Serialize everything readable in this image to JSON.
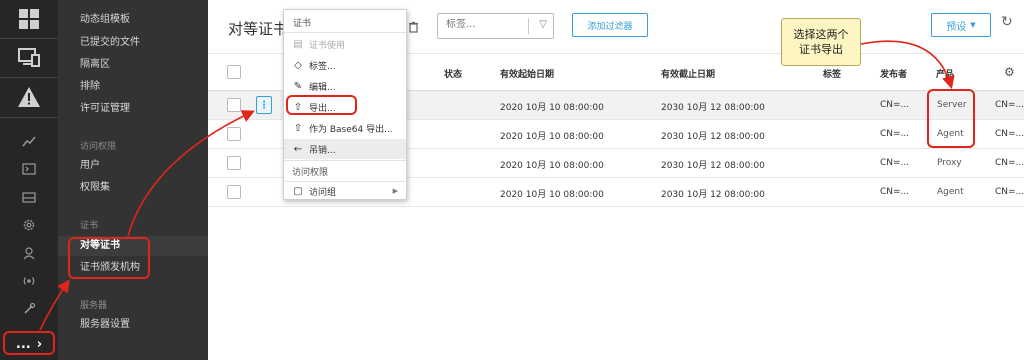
{
  "rail": {
    "icons": [
      "dashboard-grid-icon",
      "devices-icon",
      "warning-icon",
      "chart-icon",
      "terminal-icon",
      "inbox-icon",
      "settings-icon",
      "user-icon",
      "broadcast-icon",
      "tools-icon"
    ],
    "more_label": "..."
  },
  "nav": {
    "items_top": [
      "动态组模板",
      "已提交的文件",
      "隔离区",
      "排除",
      "许可证管理"
    ],
    "section_access": "访问权限",
    "items_access": [
      "用户",
      "权限集"
    ],
    "section_cert": "证书",
    "items_cert": [
      "对等证书",
      "证书颁发机构"
    ],
    "section_server": "服务器",
    "items_server": [
      "服务器设置"
    ]
  },
  "header": {
    "title": "对等证书",
    "tags_placeholder": "标签...",
    "add_filter": "添加过滤器",
    "preset": "预设"
  },
  "table": {
    "columns": [
      "状态",
      "有效起始日期",
      "有效截止日期",
      "标签",
      "发布者",
      "产品"
    ],
    "rows": [
      {
        "valid_from": "2020 10月 10 08:00:00",
        "valid_to": "2030 10月 12 08:00:00",
        "issuer": "CN=...",
        "product": "Server",
        "extra": "CN=..."
      },
      {
        "valid_from": "2020 10月 10 08:00:00",
        "valid_to": "2030 10月 12 08:00:00",
        "issuer": "CN=...",
        "product": "Agent",
        "extra": "CN=..."
      },
      {
        "valid_from": "2020 10月 10 08:00:00",
        "valid_to": "2030 10月 12 08:00:00",
        "issuer": "CN=...",
        "product": "Proxy",
        "extra": "CN=..."
      },
      {
        "valid_from": "2020 10月 10 08:00:00",
        "valid_to": "2030 10月 12 08:00:00",
        "issuer": "CN=...",
        "product": "Agent",
        "extra": "CN=..."
      }
    ]
  },
  "context_menu": {
    "title": "证书",
    "items": [
      {
        "label": "证书使用",
        "icon": "certificate-icon",
        "disabled": true
      },
      {
        "label": "标签...",
        "icon": "tag-icon"
      },
      {
        "label": "编辑...",
        "icon": "pencil-icon"
      },
      {
        "label": "导出...",
        "icon": "export-icon"
      },
      {
        "label": "作为 Base64 导出...",
        "icon": "export-base64-icon"
      },
      {
        "label": "吊销...",
        "icon": "revoke-arrow-icon"
      }
    ],
    "access_section": "访问权限",
    "access_group": "访问组"
  },
  "callout": {
    "line1": "选择这两个",
    "line2": "证书导出"
  },
  "colors": {
    "accent": "#3a9fd8",
    "annotation_red": "#e0251b",
    "callout_bg": "#fdf6c3",
    "rail_bg": "#262626",
    "nav_bg": "#333333"
  }
}
